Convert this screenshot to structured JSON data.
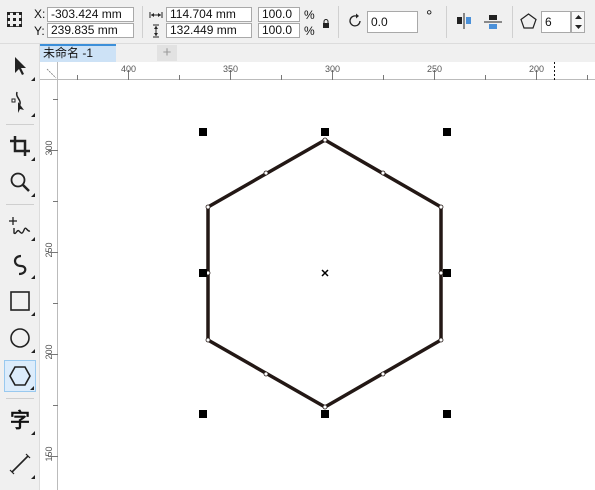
{
  "propbar": {
    "x_label": "X:",
    "y_label": "Y:",
    "x_value": "-303.424 mm",
    "y_value": "239.835 mm",
    "width_value": "114.704 mm",
    "height_value": "132.449 mm",
    "scale_x": "100.0",
    "scale_y": "100.0",
    "percent_symbol": "%",
    "rotation_value": "0.0",
    "degree_symbol": "°",
    "sides_value": "6",
    "icons": [
      "position-grid-icon",
      "width-icon",
      "height-icon",
      "lock-ratio-icon",
      "rotate-icon",
      "mirror-horizontal-icon",
      "mirror-vertical-icon",
      "polygon-icon",
      "spin-up-icon",
      "spin-down-icon"
    ]
  },
  "document": {
    "tab_label": "未命名 -1",
    "add_tab_label": "+"
  },
  "toolbox": {
    "tools": [
      {
        "name": "pick-tool",
        "icon": "arrow-cursor-icon"
      },
      {
        "name": "shape-tool",
        "icon": "node-edit-icon"
      },
      {
        "name": "crop-tool",
        "icon": "crop-icon"
      },
      {
        "name": "zoom-tool",
        "icon": "magnifier-icon"
      },
      {
        "name": "freehand-tool",
        "icon": "freehand-pen-icon"
      },
      {
        "name": "artistic-media-tool",
        "icon": "spiral-curve-icon"
      },
      {
        "name": "rectangle-tool",
        "icon": "rectangle-icon"
      },
      {
        "name": "ellipse-tool",
        "icon": "circle-icon"
      },
      {
        "name": "polygon-tool",
        "icon": "hexagon-icon",
        "active": true
      },
      {
        "name": "text-tool",
        "icon": "text-char-icon",
        "glyph": "字"
      },
      {
        "name": "dimension-tool",
        "icon": "line-tool-icon"
      }
    ]
  },
  "rulers": {
    "horizontal_labels": [
      "400",
      "350",
      "300",
      "250",
      "200"
    ],
    "vertical_labels": [
      "300",
      "250",
      "200",
      "150"
    ]
  },
  "colors": {
    "shape_stroke": "#231815",
    "selection_handle": "#000000",
    "active_tab": "#cde2f6",
    "active_tool": "#dcecfb"
  }
}
